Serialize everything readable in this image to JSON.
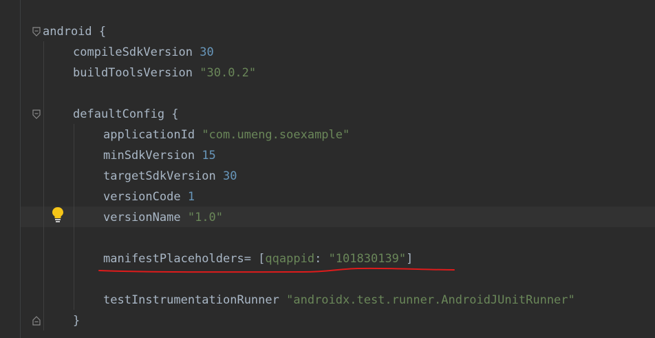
{
  "editor": {
    "lines": {
      "android_open": {
        "keyword": "android",
        "brace": " {"
      },
      "compile_sdk": {
        "key": "compileSdkVersion",
        "value": "30"
      },
      "build_tools": {
        "key": "buildToolsVersion",
        "value": "\"30.0.2\""
      },
      "default_config_open": {
        "keyword": "defaultConfig",
        "brace": " {"
      },
      "application_id": {
        "key": "applicationId",
        "value": "\"com.umeng.soexample\""
      },
      "min_sdk": {
        "key": "minSdkVersion",
        "value": "15"
      },
      "target_sdk": {
        "key": "targetSdkVersion",
        "value": "30"
      },
      "version_code": {
        "key": "versionCode",
        "value": "1"
      },
      "version_name": {
        "key": "versionName",
        "value": "\"1.0\""
      },
      "manifest_placeholders": {
        "key": "manifestPlaceholders=",
        "open_bracket": " [",
        "map_key": "qqappid",
        "colon": ": ",
        "value": "\"101830139\"",
        "close_bracket": "]"
      },
      "test_runner": {
        "key": "testInstrumentationRunner",
        "value": "\"androidx.test.runner.AndroidJUnitRunner\""
      },
      "default_config_close": {
        "brace": "}"
      }
    },
    "colors": {
      "background": "#2b2b2b",
      "text": "#a9b7c6",
      "string": "#6a8759",
      "number": "#6897bb",
      "annotation_underline": "#e01b1b",
      "intention_bulb": "#f5c518"
    },
    "icons": {
      "fold_markers": [
        "fold-open-icon",
        "fold-open-icon",
        "fold-close-icon"
      ],
      "intention": "lightbulb-icon"
    }
  }
}
